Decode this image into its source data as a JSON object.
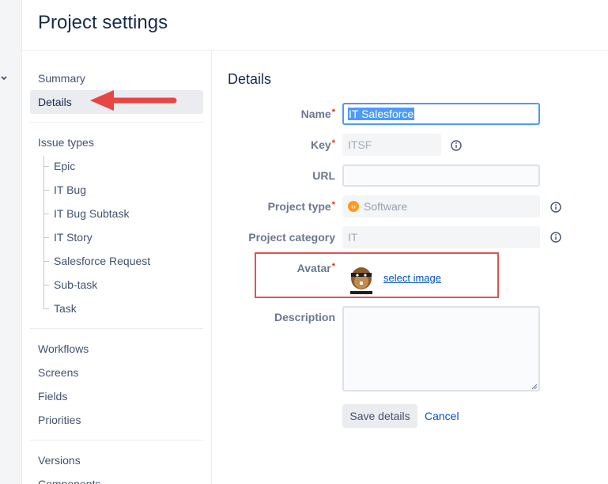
{
  "header": {
    "title": "Project settings"
  },
  "sidebar": {
    "summary": "Summary",
    "details": "Details",
    "issue_types": "Issue types",
    "issue_type_children": [
      "Epic",
      "IT Bug",
      "IT Bug Subtask",
      "IT Story",
      "Salesforce Request",
      "Sub-task",
      "Task"
    ],
    "workflows": "Workflows",
    "screens": "Screens",
    "fields": "Fields",
    "priorities": "Priorities",
    "versions": "Versions",
    "components": "Components"
  },
  "main": {
    "section_title": "Details",
    "required_marker": "*",
    "name_label": "Name",
    "name_value": "IT Salesforce",
    "key_label": "Key",
    "key_value": "ITSF",
    "url_label": "URL",
    "url_value": "",
    "project_type_label": "Project type",
    "project_type_value": "Software",
    "project_category_label": "Project category",
    "project_category_value": "IT",
    "avatar_label": "Avatar",
    "select_image": "select image",
    "description_label": "Description",
    "description_value": "",
    "save_button": "Save details",
    "cancel_link": "Cancel"
  },
  "colors": {
    "accent": "#0052cc",
    "required": "#de350b",
    "highlight_box": "#e05353",
    "arrow": "#e84545",
    "software_icon": "#ff991f"
  },
  "icons": {
    "collapse": "chevron-down-icon",
    "info": "info-icon",
    "project_type": "software-icon",
    "avatar": "beaver-avatar-icon",
    "annotation": "red-arrow-icon"
  }
}
